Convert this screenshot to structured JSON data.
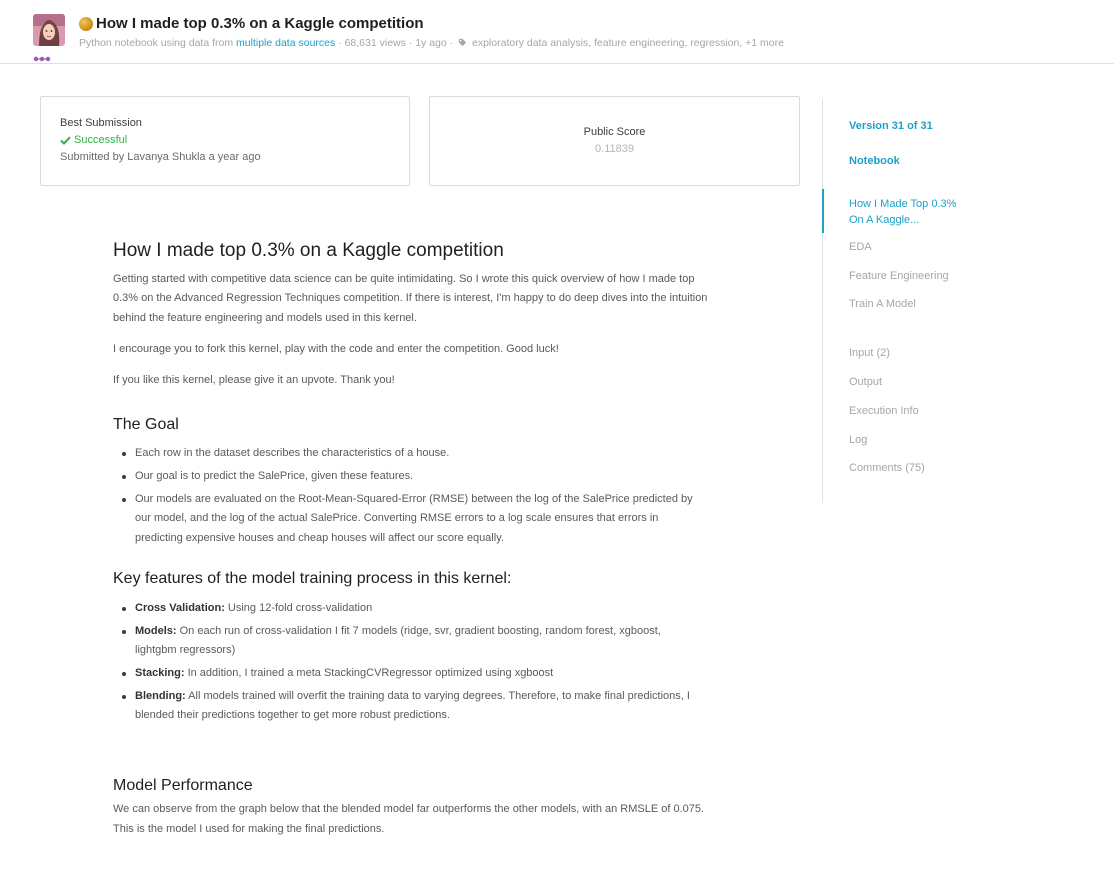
{
  "header": {
    "title": "How I made top 0.3% on a Kaggle competition",
    "meta_prefix": "Python notebook using data from",
    "meta_link": "multiple data sources",
    "meta_stats": "· 68,631 views · 1y ago ·",
    "meta_tags": "exploratory data analysis, feature engineering, regression, +1 more"
  },
  "best_submission": {
    "label": "Best Submission",
    "status": "Successful",
    "submitted_by": "Submitted by Lavanya Shukla a year ago"
  },
  "public_score": {
    "label": "Public Score",
    "value": "0.11839"
  },
  "sidebar": {
    "version": "Version 31 of 31",
    "notebook": "Notebook",
    "toc_active_line1": "How I Made Top 0.3%",
    "toc_active_line2": "On A Kaggle...",
    "toc": [
      "EDA",
      "Feature Engineering",
      "Train A Model"
    ],
    "links": [
      "Input (2)",
      "Output",
      "Execution Info",
      "Log",
      "Comments (75)"
    ]
  },
  "content": {
    "title": "How I made top 0.3% on a Kaggle competition",
    "intro_line1": "Getting started with competitive data science can be quite intimidating. So I wrote this quick overview of how I made top",
    "intro_line2": "0.3% on the Advanced Regression Techniques competition. If there is interest, I'm happy to do deep dives into the intuition",
    "intro_line3": "behind the feature engineering and models used in this kernel.",
    "fork_text": "I encourage you to fork this kernel, play with the code and enter the competition. Good luck!",
    "upvote_text": "If you like this kernel, please give it an upvote. Thank you!",
    "goal_heading": "The Goal",
    "goal_items": [
      [
        "Each row in the dataset describes the characteristics of a house."
      ],
      [
        "Our goal is to predict the SalePrice, given these features."
      ],
      [
        "Our models are evaluated on the Root-Mean-Squared-Error (RMSE) between the log of the SalePrice predicted by",
        "our model, and the log of the actual SalePrice. Converting RMSE errors to a log scale ensures that errors in",
        "predicting expensive houses and cheap houses will affect our score equally."
      ]
    ],
    "features_heading": "Key features of the model training process in this kernel:",
    "features": [
      {
        "bold": "Cross Validation:",
        "lines": [
          "Using 12-fold cross-validation"
        ]
      },
      {
        "bold": "Models:",
        "lines": [
          "On each run of cross-validation I fit 7 models (ridge, svr, gradient boosting, random forest, xgboost,",
          "lightgbm regressors)"
        ]
      },
      {
        "bold": "Stacking:",
        "lines": [
          "In addition, I trained a meta StackingCVRegressor optimized using xgboost"
        ]
      },
      {
        "bold": "Blending:",
        "lines": [
          "All models trained will overfit the training data to varying degrees. Therefore, to make final predictions, I",
          "blended their predictions together to get more robust predictions."
        ]
      }
    ],
    "performance_heading": "Model Performance",
    "performance_line1": "We can observe from the graph below that the blended model far outperforms the other models, with an RMSLE of 0.075.",
    "performance_line2": "This is the model I used for making the final predictions."
  },
  "colors": {
    "accent": "#1ea0c7",
    "success": "#2db149",
    "medal": "#c58a14"
  }
}
